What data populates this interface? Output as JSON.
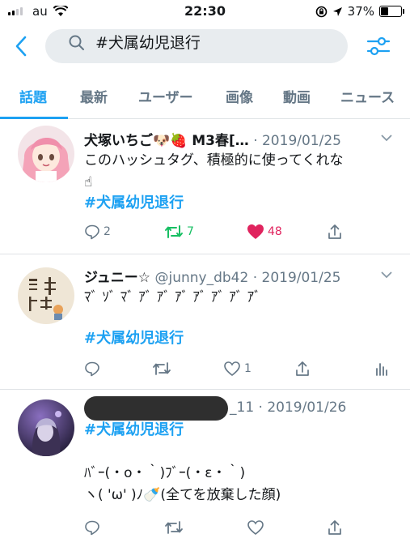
{
  "status_bar": {
    "carrier": "au",
    "time": "22:30",
    "battery": "37%",
    "battery_level": 0.37
  },
  "search": {
    "query": "#犬属幼児退行",
    "icons": [
      "back-arrow-icon",
      "search-icon",
      "filter-sliders-icon"
    ]
  },
  "tabs": [
    {
      "label": "話題",
      "active": true
    },
    {
      "label": "最新"
    },
    {
      "label": "ユーザー"
    },
    {
      "label": "画像"
    },
    {
      "label": "動画"
    },
    {
      "label": "ニュース"
    }
  ],
  "tweets": [
    {
      "name": "犬塚いちご🐶🍓 M3春[…",
      "meta": "· 2019/01/25",
      "text_lines": [
        "このハッシュタグ、積極的に使ってくれな",
        "☝"
      ],
      "hashtag": "#犬属幼児退行",
      "reply_count": "2",
      "retweet_count": "7",
      "like_count": "48",
      "retweeted": true,
      "liked": true,
      "colors": {
        "retweet": "#17bf63",
        "like": "#e0245e"
      }
    },
    {
      "name": "ジュニー☆",
      "meta": "@junny_db42 · 2019/01/25",
      "text_lines": [
        "ﾏﾞ ｿﾞ ﾏﾞ ｱﾞ ｱﾞ ｱﾞ ｱﾞ ｱﾞ ｱﾞ ｱﾞ"
      ],
      "hashtag": "#犬属幼児退行",
      "reply_count": "",
      "retweet_count": "",
      "like_count": "1"
    },
    {
      "name": "",
      "meta": "_11 · 2019/01/26",
      "hashtag": "#犬属幼児退行",
      "text_lines": [
        "ﾊﾞｰ(・ο・｀)ﾌﾞｰ(・ε・｀)",
        "ヽ( 'ω' )ﾉ🍼(全てを放棄した顔)"
      ]
    }
  ],
  "colors": {
    "accent": "#1da1f2",
    "muted": "#657786",
    "divider": "#dfe3e6"
  }
}
